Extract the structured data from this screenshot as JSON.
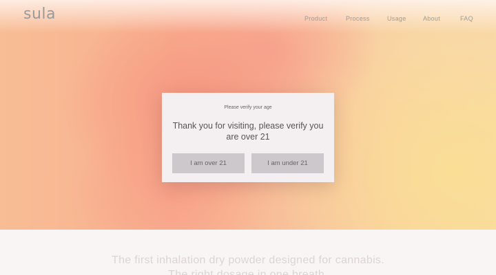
{
  "brand": {
    "logo_text": "sula"
  },
  "nav": {
    "items": [
      {
        "label": "Product"
      },
      {
        "label": "Process"
      },
      {
        "label": "Usage"
      },
      {
        "label": "About"
      },
      {
        "label": "FAQ"
      }
    ]
  },
  "age_gate": {
    "eyebrow": "Please verify your age",
    "title": "Thank you for visiting, please verify you are over 21",
    "confirm_label": "I am over 21",
    "deny_label": "I am under 21"
  },
  "hero_section": {
    "tagline": "The first inhalation dry powder designed for cannabis. The right dosage in one breath."
  },
  "colors": {
    "modal_bg": "#f4eff0",
    "button_bg": "#ccc8cb",
    "text_gray": "#9b9b9b",
    "gradient_peach": "#f8b08f",
    "gradient_yellow": "#f9dba2"
  }
}
